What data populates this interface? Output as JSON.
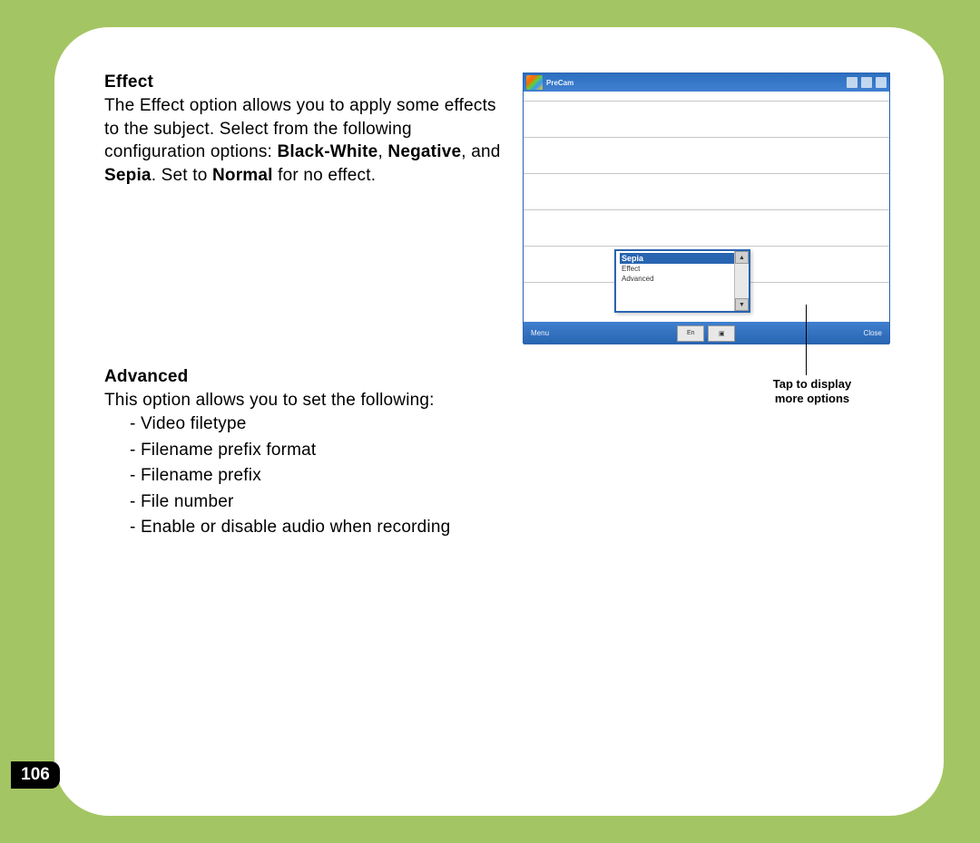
{
  "page": {
    "number": "106"
  },
  "sections": {
    "effect": {
      "heading": "Effect",
      "body_pre": "The Effect option allows you to apply some effects to the subject. Select from the following configuration options: ",
      "opt1": "Black-White",
      "sep1": ", ",
      "opt2": "Negative",
      "sep2": ", and ",
      "opt3": "Sepia",
      "sep3": ". Set to ",
      "opt4": "Normal",
      "body_post": " for no effect."
    },
    "advanced": {
      "heading": "Advanced",
      "intro": "This option allows you to set the following:",
      "items": {
        "0": "- Video filetype",
        "1": "- Filename prefix format",
        "2": "- Filename prefix",
        "3": "- File number",
        "4": "- Enable or disable audio when recording"
      }
    }
  },
  "screenshot": {
    "topbar_title": "PreCam",
    "popup_selected": "Sepia",
    "popup_item1": "Effect",
    "popup_item2": "Advanced",
    "bottom_left": "Menu",
    "bottom_btn1": "En",
    "bottom_btn2": "▣",
    "bottom_right": "Close"
  },
  "caption": {
    "line1": "Tap to display",
    "line2": "more options"
  }
}
